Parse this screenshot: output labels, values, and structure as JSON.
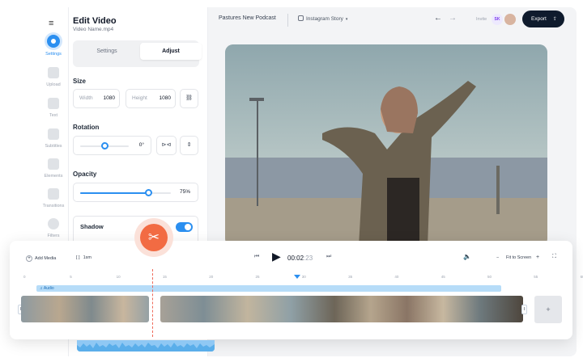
{
  "app": {
    "title": "Edit Video",
    "file_name": "Video Name.mp4",
    "project_name": "Pastures New Podcast",
    "format": "Instagram Story",
    "invite_label": "Invite",
    "avatar_initials": "SK",
    "export_label": "Export"
  },
  "rail": {
    "items": [
      {
        "label": "Settings",
        "icon": "gear-icon",
        "active": true
      },
      {
        "label": "Upload",
        "icon": "upload-icon"
      },
      {
        "label": "Text",
        "icon": "text-icon"
      },
      {
        "label": "Subtitles",
        "icon": "subtitles-icon"
      },
      {
        "label": "Elements",
        "icon": "elements-icon"
      },
      {
        "label": "Transitions",
        "icon": "transitions-icon"
      },
      {
        "label": "Filters",
        "icon": "filters-icon"
      }
    ]
  },
  "panel": {
    "tabs": [
      "Settings",
      "Adjust"
    ],
    "active_tab": "Adjust",
    "size": {
      "title": "Size",
      "width_label": "Width",
      "width_value": "1080",
      "height_label": "Height",
      "height_value": "1080"
    },
    "rotation": {
      "title": "Rotation",
      "value": "0°",
      "level": 0.5
    },
    "opacity": {
      "title": "Opacity",
      "value": "75%",
      "level": 0.75
    },
    "shadow": {
      "title": "Shadow",
      "enabled": true
    }
  },
  "timeline": {
    "add_media_label": "Add Media",
    "split_label": "1sm",
    "current_time": "00:02",
    "current_frame": ":23",
    "fit_label": "Fit to Screen",
    "ticks": [
      "0",
      "5",
      "10",
      "15",
      "20",
      "25",
      "30",
      "35",
      "40",
      "45",
      "50",
      "55",
      "60"
    ],
    "audio_label": "Audio"
  },
  "colors": {
    "accent": "#2b8ff0",
    "cut": "#f26b43",
    "export_bg": "#0f1b2d"
  }
}
